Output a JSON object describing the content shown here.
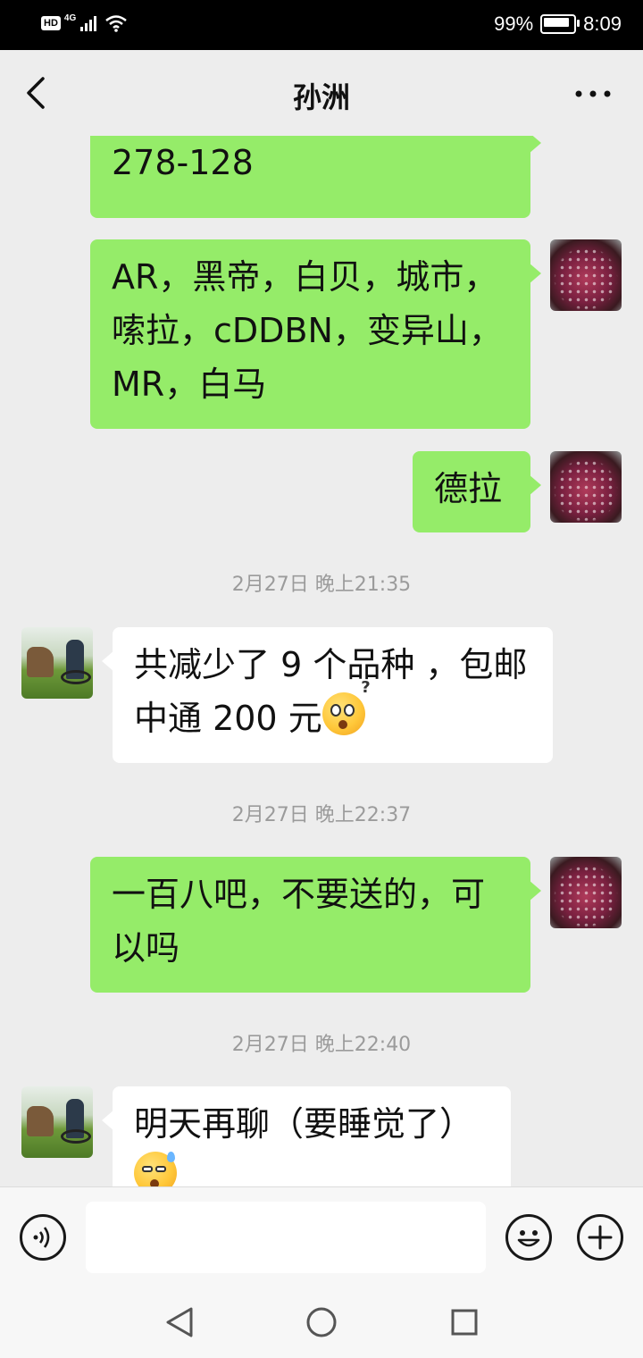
{
  "status_bar": {
    "hd": "HD",
    "network": "4G",
    "battery_percent": "99%",
    "battery_level": 0.99,
    "time": "8:09"
  },
  "header": {
    "title": "孙洲",
    "back_icon": "chevron-left-icon",
    "more_icon": "more-dots-icon"
  },
  "messages": {
    "m1": {
      "sender": "me",
      "text": "278-128"
    },
    "m2": {
      "sender": "me",
      "text": "AR，黑帝，白贝，城市，嗦拉，cDDBN，变异山，MR，白马"
    },
    "m3": {
      "sender": "me",
      "text": "德拉"
    },
    "t1": "2月27日 晚上21:35",
    "m4": {
      "sender": "other",
      "text": "共减少了 9 个品种 ，包邮中通 200 元",
      "emoji": "confused-face-emoji"
    },
    "t2": "2月27日 晚上22:37",
    "m5": {
      "sender": "me",
      "text": "一百八吧，不要送的，可以吗"
    },
    "t3": "2月27日 晚上22:40",
    "m6": {
      "sender": "other",
      "text": "明天再聊（要睡觉了）",
      "emoji": "sweat-face-emoji"
    }
  },
  "input_bar": {
    "voice_icon": "voice-icon",
    "input_value": "",
    "emoji_icon": "smiley-icon",
    "plus_icon": "plus-icon"
  },
  "nav_bar": {
    "back_icon": "triangle-back-icon",
    "home_icon": "circle-home-icon",
    "recent_icon": "square-recent-icon"
  },
  "colors": {
    "my_bubble": "#95ec69",
    "other_bubble": "#ffffff",
    "background": "#ededed"
  }
}
